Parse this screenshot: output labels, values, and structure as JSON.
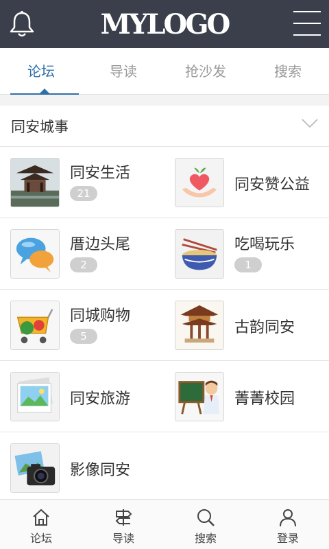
{
  "header": {
    "logo": "MYLOGO",
    "left_icon": "bell-icon",
    "right_icon": "menu-icon"
  },
  "tabs": [
    {
      "label": "论坛",
      "active": true
    },
    {
      "label": "导读",
      "active": false
    },
    {
      "label": "抢沙发",
      "active": false
    },
    {
      "label": "搜索",
      "active": false
    }
  ],
  "section": {
    "title": "同安城事",
    "icon": "chevron-down-icon"
  },
  "forums": [
    {
      "name": "同安生活",
      "count": "21",
      "icon": "pavilion-photo"
    },
    {
      "name": "同安赞公益",
      "count": null,
      "icon": "heart-hands-icon"
    },
    {
      "name": "厝边头尾",
      "count": "2",
      "icon": "chat-bubbles-icon"
    },
    {
      "name": "吃喝玩乐",
      "count": "1",
      "icon": "noodle-bowl-icon"
    },
    {
      "name": "同城购物",
      "count": "5",
      "icon": "shopping-cart-icon"
    },
    {
      "name": "古韵同安",
      "count": null,
      "icon": "pagoda-icon"
    },
    {
      "name": "同安旅游",
      "count": null,
      "icon": "landscape-photo-icon"
    },
    {
      "name": "菁菁校园",
      "count": null,
      "icon": "teacher-board-icon"
    },
    {
      "name": "影像同安",
      "count": null,
      "icon": "camera-icon"
    }
  ],
  "bottom_nav": [
    {
      "label": "论坛",
      "icon": "home-icon"
    },
    {
      "label": "导读",
      "icon": "signpost-icon"
    },
    {
      "label": "搜索",
      "icon": "search-icon"
    },
    {
      "label": "登录",
      "icon": "user-icon"
    }
  ],
  "colors": {
    "header_bg": "#3a3f4b",
    "accent": "#2f6fa8",
    "badge": "#cfcfcf"
  }
}
